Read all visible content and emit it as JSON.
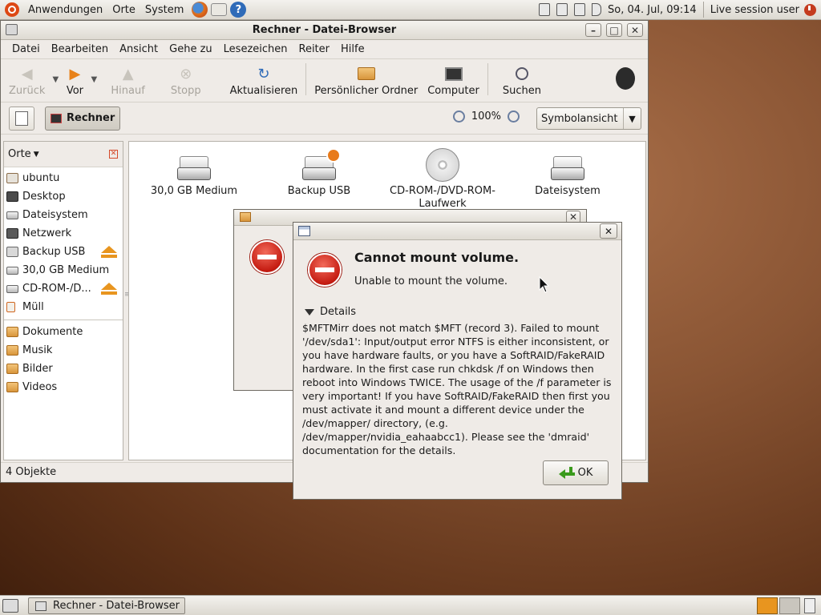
{
  "top_panel": {
    "menus": [
      "Anwendungen",
      "Orte",
      "System"
    ],
    "clock": "So, 04. Jul, 09:14",
    "user": "Live session user"
  },
  "file_browser": {
    "title": "Rechner - Datei-Browser",
    "menubar": [
      "Datei",
      "Bearbeiten",
      "Ansicht",
      "Gehe zu",
      "Lesezeichen",
      "Reiter",
      "Hilfe"
    ],
    "toolbar": {
      "back": "Zurück",
      "forward": "Vor",
      "up": "Hinauf",
      "stop": "Stopp",
      "reload": "Aktualisieren",
      "home": "Persönlicher Ordner",
      "computer": "Computer",
      "search": "Suchen"
    },
    "location": {
      "current": "Rechner",
      "zoom": "100%",
      "view_mode": "Symbolansicht"
    },
    "sidebar": {
      "header": "Orte",
      "places": [
        "ubuntu",
        "Desktop",
        "Dateisystem",
        "Netzwerk",
        "Backup USB",
        "30,0 GB Medium",
        "CD-ROM-/D...",
        "Müll"
      ],
      "bookmarks": [
        "Dokumente",
        "Musik",
        "Bilder",
        "Videos"
      ]
    },
    "icons": [
      "30,0 GB Medium",
      "Backup USB",
      "CD-ROM-/DVD-ROM-Laufwerk",
      "Dateisystem"
    ],
    "status": "4 Objekte"
  },
  "dialog": {
    "heading": "Cannot mount volume.",
    "message": "Unable to mount the volume.",
    "details_label": "Details",
    "details_text": "$MFTMirr does not match $MFT (record 3). Failed to mount '/dev/sda1': Input/output error NTFS is either inconsistent, or you have hardware faults, or you have a SoftRAID/FakeRAID hardware. In the first case run chkdsk /f on Windows then reboot into Windows TWICE. The usage of the /f parameter is very important! If you have SoftRAID/FakeRAID then first you must activate it and mount a different device under the /dev/mapper/ directory, (e.g. /dev/mapper/nvidia_eahaabcc1). Please see the 'dmraid' documentation for the details.",
    "ok_label": "OK"
  },
  "taskbar": {
    "task": "Rechner - Datei-Browser"
  }
}
